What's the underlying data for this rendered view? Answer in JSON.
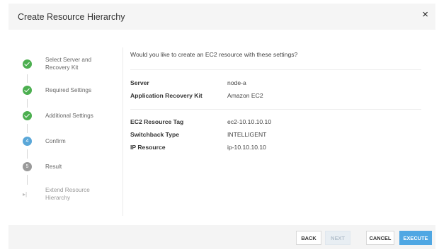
{
  "dialog": {
    "title": "Create Resource Hierarchy",
    "close_symbol": "×"
  },
  "steps": [
    {
      "label": "Select Server and Recovery Kit",
      "state": "done",
      "icon": "check-icon"
    },
    {
      "label": "Required Settings",
      "state": "done",
      "icon": "check-icon"
    },
    {
      "label": "Additional Settings",
      "state": "done",
      "icon": "check-icon"
    },
    {
      "label": "Confirm",
      "state": "current",
      "number": "4"
    },
    {
      "label": "Result",
      "state": "pending",
      "number": "5"
    },
    {
      "label": "Extend Resource Hierarchy",
      "state": "skipped",
      "icon": "skip-next-icon",
      "symbol": "▸|"
    }
  ],
  "content": {
    "question": "Would you like to create an EC2 resource with these settings?",
    "group1": [
      {
        "key": "Server",
        "value": "node-a"
      },
      {
        "key": "Application Recovery Kit",
        "value": "Amazon EC2"
      }
    ],
    "group2": [
      {
        "key": "EC2 Resource Tag",
        "value": "ec2-10.10.10.10"
      },
      {
        "key": "Switchback Type",
        "value": "INTELLIGENT"
      },
      {
        "key": "IP Resource",
        "value": "ip-10.10.10.10"
      }
    ]
  },
  "footer": {
    "back": "BACK",
    "next": "NEXT",
    "cancel": "CANCEL",
    "execute": "EXECUTE"
  },
  "colors": {
    "done": "#4caf50",
    "current": "#5aa7d8",
    "pending": "#9a9a9a",
    "primary_button": "#4fa7e3"
  }
}
